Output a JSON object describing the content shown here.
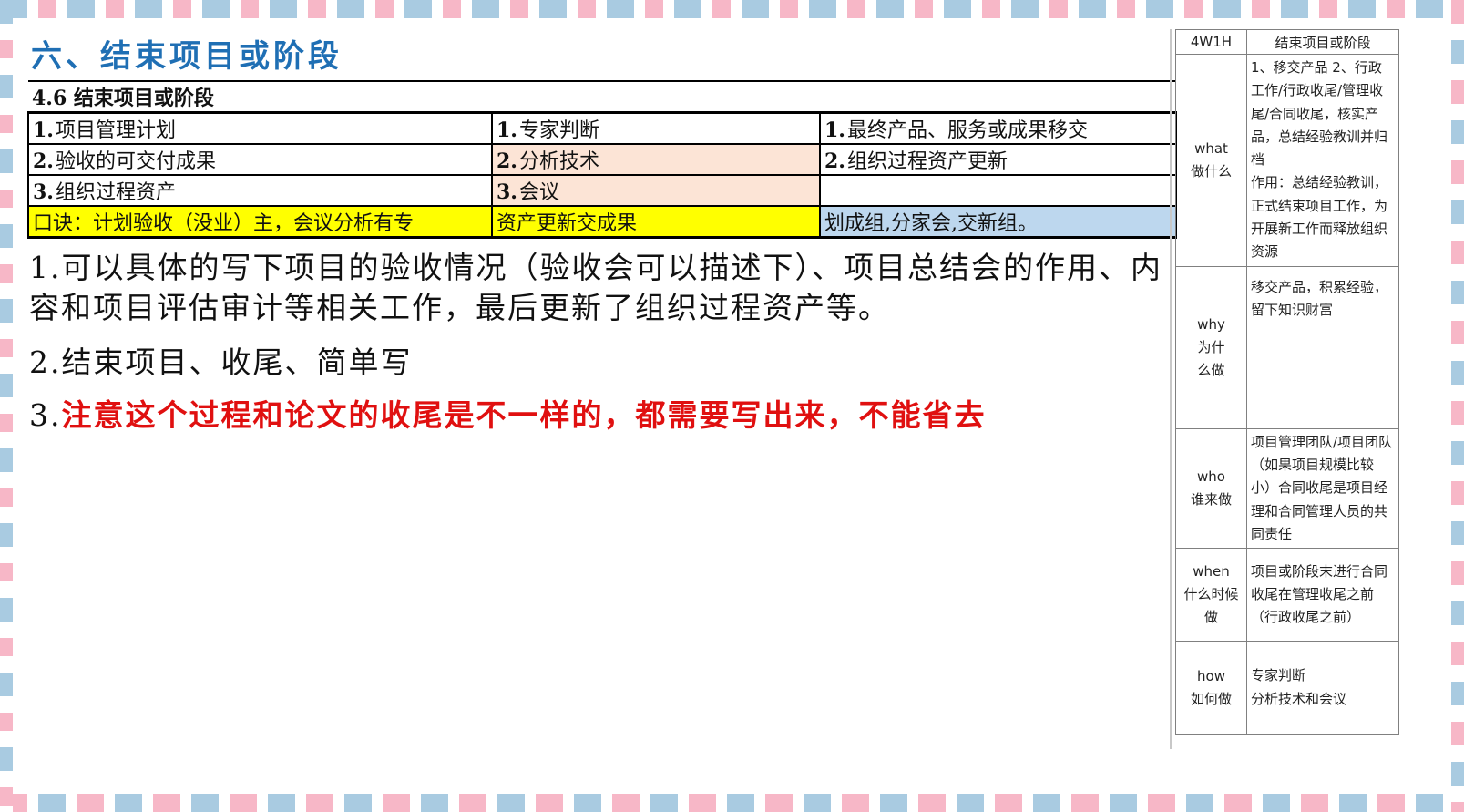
{
  "title": "六、结束项目或阶段",
  "process_table": {
    "header": "4.6 结束项目或阶段",
    "rows": [
      [
        {
          "num": "1.",
          "text": "项目管理计划"
        },
        {
          "num": "1.",
          "text": "专家判断"
        },
        {
          "num": "1.",
          "text": "最终产品、服务或成果移交"
        }
      ],
      [
        {
          "num": "2.",
          "text": "验收的可交付成果"
        },
        {
          "num": "2.",
          "text": "分析技术"
        },
        {
          "num": "2.",
          "text": "组织过程资产更新"
        }
      ],
      [
        {
          "num": "3.",
          "text": "组织过程资产"
        },
        {
          "num": "3.",
          "text": "会议"
        },
        {
          "num": "",
          "text": ""
        }
      ]
    ],
    "mnemonic": [
      "口诀：计划验收（没业）主，会议分析有专",
      "资产更新交成果",
      "划成组,分家会,交新组。"
    ]
  },
  "body": {
    "p1": "1.可以具体的写下项目的验收情况（验收会可以描述下）、项目总结会的作用、内容和项目评估审计等相关工作，最后更新了组织过程资产等。",
    "p2": "2.结束项目、收尾、简单写",
    "p3_num": "3.",
    "p3_red": "注意这个过程和论文的收尾是不一样的，都需要写出来，不能省去"
  },
  "w4h1": {
    "header_key": "4W1H",
    "header_value": "结束项目或阶段",
    "rows": [
      {
        "en": "what",
        "cn": "做什么",
        "value": "1、移交产品 2、行政工作/行政收尾/管理收尾/合同收尾，核实产品，总结经验教训并归档\n作用：总结经验教训，正式结束项目工作，为开展新工作而释放组织资源"
      },
      {
        "en": "why",
        "cn": "为什么做",
        "value": "移交产品，积累经验，留下知识财富"
      },
      {
        "en": "who",
        "cn": "谁来做",
        "value": "项目管理团队/项目团队（如果项目规模比较小）合同收尾是项目经理和合同管理人员的共同责任"
      },
      {
        "en": "when",
        "cn": "什么时候做",
        "value": "项目或阶段末进行合同收尾在管理收尾之前（行政收尾之前）"
      },
      {
        "en": "how",
        "cn": "如何做",
        "value": "专家判断\n分析技术和会议"
      }
    ]
  }
}
